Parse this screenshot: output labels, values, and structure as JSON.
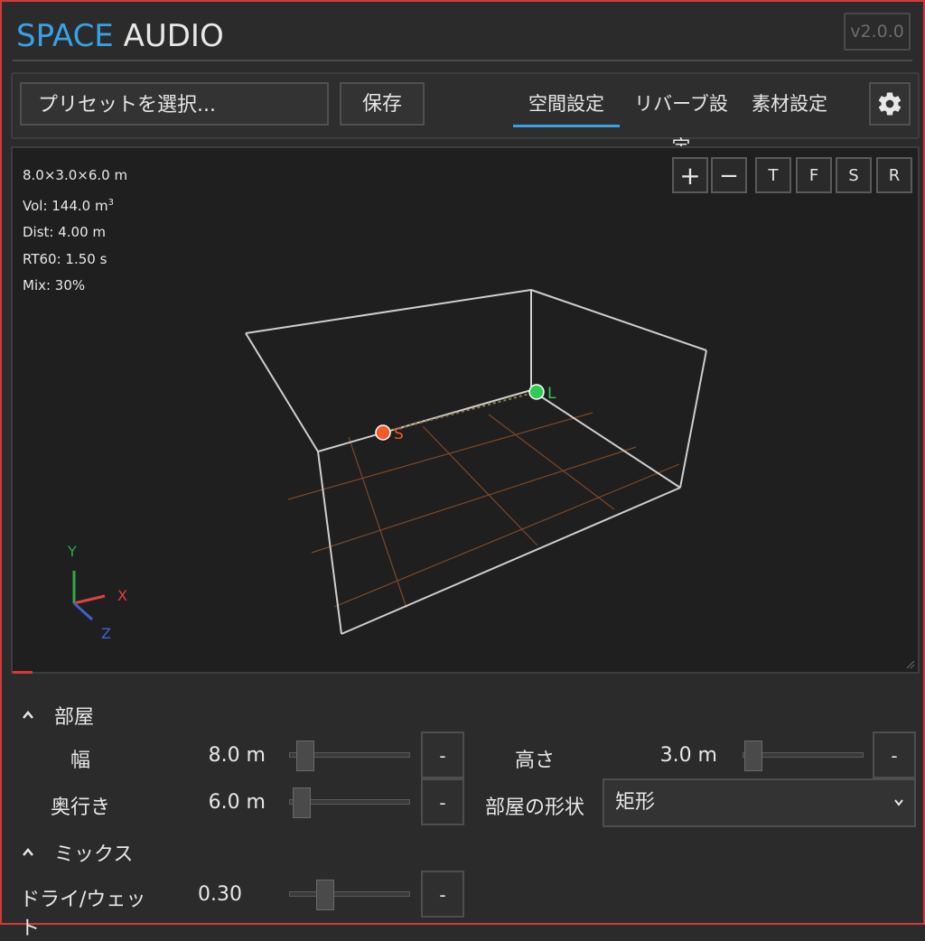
{
  "header": {
    "title_accent": "SPACE",
    "title_rest": "AUDIO",
    "version": "v2.0.0"
  },
  "toolbar": {
    "preset_placeholder": "プリセットを選択...",
    "save_label": "保存",
    "tabs": [
      {
        "label": "空間設定",
        "active": true
      },
      {
        "label": "リバーブ設定",
        "active": false
      },
      {
        "label": "素材設定",
        "active": false
      }
    ],
    "settings_icon": "gear-icon"
  },
  "viewport": {
    "info": {
      "dimensions": "8.0×3.0×6.0 m",
      "volume_prefix": "Vol: 144.0 m",
      "volume_sup": "3",
      "distance": "Dist: 4.00 m",
      "rt60": "RT60: 1.50 s",
      "mix": "Mix: 30%"
    },
    "view_buttons": [
      "+",
      "−",
      "T",
      "F",
      "S",
      "R"
    ],
    "source_label": "S",
    "listener_label": "L",
    "axes": {
      "x": "X",
      "y": "Y",
      "z": "Z"
    },
    "colors": {
      "source": "#f25a2a",
      "listener": "#2ecc55",
      "grid": "#7a4a2a",
      "edge": "#cfcfcf",
      "axis_x": "#e04040",
      "axis_y": "#2eaa4a",
      "axis_z": "#4060d0"
    }
  },
  "room_section": {
    "title": "部屋",
    "width": {
      "label": "幅",
      "value": "8.0 m",
      "slider": 0.1
    },
    "height": {
      "label": "高さ",
      "value": "3.0 m",
      "slider": 0.1
    },
    "depth": {
      "label": "奥行き",
      "value": "6.0 m",
      "slider": 0.08
    },
    "shape": {
      "label": "部屋の形状",
      "value": "矩形"
    },
    "minus_label": "-"
  },
  "mix_section": {
    "title": "ミックス",
    "drywet": {
      "label": "ドライ/ウェット",
      "value": "0.30",
      "slider": 0.3
    },
    "minus_label": "-"
  }
}
